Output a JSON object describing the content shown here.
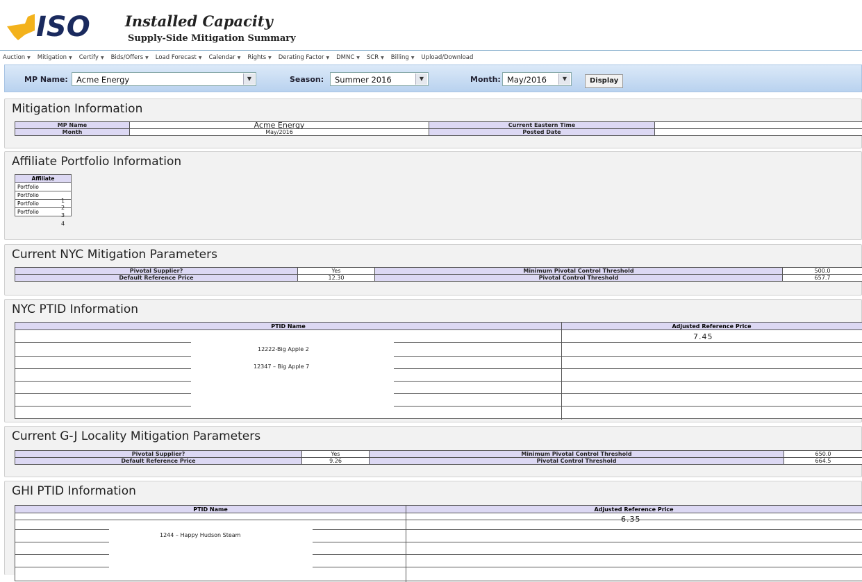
{
  "header": {
    "logo_text": "ISO",
    "title": "Installed Capacity",
    "subtitle": "Supply-Side Mitigation Summary"
  },
  "menu": [
    "Auction",
    "Mitigation",
    "Certify",
    "Bids/Offers",
    "Load Forecast",
    "Calendar",
    "Rights",
    "Derating Factor",
    "DMNC",
    "SCR",
    "Billing",
    "Upload/Download"
  ],
  "filters": {
    "mp_name_label": "MP Name:",
    "mp_name_value": "Acme Energy",
    "season_label": "Season:",
    "season_value": "Summer 2016",
    "month_label": "Month:",
    "month_value": "May/2016",
    "display_label": "Display"
  },
  "mitigation_info": {
    "title": "Mitigation Information",
    "mp_name_label": "MP Name",
    "mp_name_value": "Acme Energy",
    "month_label": "Month",
    "month_value": "May/2016",
    "eastern_time_label": "Current Eastern Time",
    "posted_date_label": "Posted Date"
  },
  "affiliate": {
    "title": "Affiliate Portfolio Information",
    "header": "Affiliate",
    "rows": [
      {
        "label": "Portfolio",
        "num": "1"
      },
      {
        "label": "Portfolio",
        "num": "2"
      },
      {
        "label": "Portfolio",
        "num": "3"
      },
      {
        "label": "Portfolio",
        "num": "4"
      }
    ]
  },
  "nyc_params": {
    "title": "Current NYC Mitigation Parameters",
    "pivotal_label": "Pivotal Supplier?",
    "pivotal_value": "Yes",
    "drp_label": "Default Reference Price",
    "drp_value": "12.30",
    "min_pct_label": "Minimum Pivotal Control Threshold",
    "min_pct_value": "500.0",
    "pct_label": "Pivotal Control Threshold",
    "pct_value": "657.7"
  },
  "nyc_ptid": {
    "title": "NYC PTID Information",
    "col1": "PTID Name",
    "col2": "Adjusted Reference Price",
    "name1": "12222-Big Apple 2",
    "name2": "12347 – Big Apple 7",
    "price": "7.45"
  },
  "gj_params": {
    "title": "Current G-J Locality Mitigation Parameters",
    "pivotal_label": "Pivotal Supplier?",
    "pivotal_value": "Yes",
    "drp_label": "Default Reference Price",
    "drp_value": "9.26",
    "min_pct_label": "Minimum Pivotal Control Threshold",
    "min_pct_value": "650.0",
    "pct_label": "Pivotal Control Threshold",
    "pct_value": "664.5"
  },
  "ghi_ptid": {
    "title": "GHI PTID Information",
    "col1": "PTID Name",
    "col2": "Adjusted Reference Price",
    "name1": "1244 – Happy Hudson Steam",
    "price": "6.35"
  },
  "colors": {
    "logo_blue": "#1a2a5e",
    "logo_yellow": "#f3b21c",
    "header_cell": "#dcd8f3",
    "filter_bar": "#c9ddf3"
  }
}
